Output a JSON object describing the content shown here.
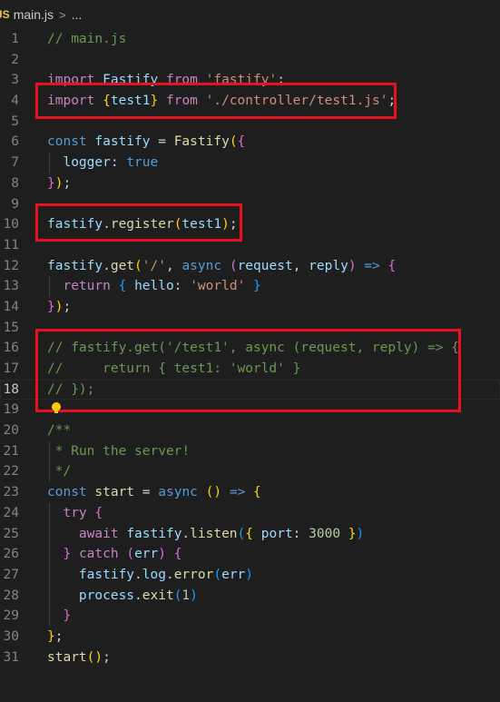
{
  "breadcrumb": {
    "badge": "JS",
    "file": "main.js",
    "separator": ">",
    "more": "..."
  },
  "lines": [
    {
      "n": "1",
      "tokens": [
        [
          "cmt",
          "// main.js"
        ]
      ]
    },
    {
      "n": "2",
      "tokens": []
    },
    {
      "n": "3",
      "tokens": [
        [
          "ctl",
          "import"
        ],
        [
          "pun",
          " "
        ],
        [
          "var",
          "Fastify"
        ],
        [
          "pun",
          " "
        ],
        [
          "ctl",
          "from"
        ],
        [
          "pun",
          " "
        ],
        [
          "str",
          "'fastify'"
        ],
        [
          "pun",
          ";"
        ]
      ]
    },
    {
      "n": "4",
      "tokens": [
        [
          "ctl",
          "import"
        ],
        [
          "pun",
          " "
        ],
        [
          "b1",
          "{"
        ],
        [
          "var",
          "test1"
        ],
        [
          "b1",
          "}"
        ],
        [
          "pun",
          " "
        ],
        [
          "ctl",
          "from"
        ],
        [
          "pun",
          " "
        ],
        [
          "str",
          "'./controller/test1.js'"
        ],
        [
          "pun",
          ";"
        ]
      ]
    },
    {
      "n": "5",
      "tokens": []
    },
    {
      "n": "6",
      "tokens": [
        [
          "kw",
          "const"
        ],
        [
          "pun",
          " "
        ],
        [
          "var",
          "fastify"
        ],
        [
          "pun",
          " = "
        ],
        [
          "fn",
          "Fastify"
        ],
        [
          "b1",
          "("
        ],
        [
          "b2",
          "{"
        ]
      ]
    },
    {
      "n": "7",
      "guide": true,
      "tokens": [
        [
          "pun",
          "  "
        ],
        [
          "var",
          "logger"
        ],
        [
          "pun",
          ": "
        ],
        [
          "kw",
          "true"
        ]
      ]
    },
    {
      "n": "8",
      "tokens": [
        [
          "b2",
          "}"
        ],
        [
          "b1",
          ")"
        ],
        [
          "pun",
          ";"
        ]
      ]
    },
    {
      "n": "9",
      "tokens": []
    },
    {
      "n": "10",
      "tokens": [
        [
          "var",
          "fastify"
        ],
        [
          "pun",
          "."
        ],
        [
          "fn",
          "register"
        ],
        [
          "b1",
          "("
        ],
        [
          "var",
          "test1"
        ],
        [
          "b1",
          ")"
        ],
        [
          "pun",
          ";"
        ]
      ]
    },
    {
      "n": "11",
      "tokens": []
    },
    {
      "n": "12",
      "tokens": [
        [
          "var",
          "fastify"
        ],
        [
          "pun",
          "."
        ],
        [
          "fn",
          "get"
        ],
        [
          "b1",
          "("
        ],
        [
          "str",
          "'/'"
        ],
        [
          "pun",
          ", "
        ],
        [
          "kw",
          "async"
        ],
        [
          "pun",
          " "
        ],
        [
          "b2",
          "("
        ],
        [
          "var",
          "request"
        ],
        [
          "pun",
          ", "
        ],
        [
          "var",
          "reply"
        ],
        [
          "b2",
          ")"
        ],
        [
          "pun",
          " "
        ],
        [
          "kw",
          "=>"
        ],
        [
          "pun",
          " "
        ],
        [
          "b2",
          "{"
        ]
      ]
    },
    {
      "n": "13",
      "guide": true,
      "tokens": [
        [
          "pun",
          "  "
        ],
        [
          "ctl",
          "return"
        ],
        [
          "pun",
          " "
        ],
        [
          "b3",
          "{"
        ],
        [
          "pun",
          " "
        ],
        [
          "var",
          "hello"
        ],
        [
          "pun",
          ": "
        ],
        [
          "str",
          "'world'"
        ],
        [
          "pun",
          " "
        ],
        [
          "b3",
          "}"
        ]
      ]
    },
    {
      "n": "14",
      "tokens": [
        [
          "b2",
          "}"
        ],
        [
          "b1",
          ")"
        ],
        [
          "pun",
          ";"
        ]
      ]
    },
    {
      "n": "15",
      "tokens": []
    },
    {
      "n": "16",
      "tokens": [
        [
          "cmt",
          "// fastify.get('/test1', async (request, reply) => {"
        ]
      ]
    },
    {
      "n": "17",
      "tokens": [
        [
          "cmt",
          "//     return { test1: 'world' }"
        ]
      ]
    },
    {
      "n": "18",
      "current": true,
      "tokens": [
        [
          "cmt",
          "// });"
        ]
      ]
    },
    {
      "n": "19",
      "tokens": []
    },
    {
      "n": "20",
      "tokens": [
        [
          "cmt",
          "/**"
        ]
      ]
    },
    {
      "n": "21",
      "guide": true,
      "tokens": [
        [
          "cmt",
          " * Run the server!"
        ]
      ]
    },
    {
      "n": "22",
      "guide": true,
      "tokens": [
        [
          "cmt",
          " */"
        ]
      ]
    },
    {
      "n": "23",
      "tokens": [
        [
          "kw",
          "const"
        ],
        [
          "pun",
          " "
        ],
        [
          "fn",
          "start"
        ],
        [
          "pun",
          " = "
        ],
        [
          "kw",
          "async"
        ],
        [
          "pun",
          " "
        ],
        [
          "b1",
          "()"
        ],
        [
          "pun",
          " "
        ],
        [
          "kw",
          "=>"
        ],
        [
          "pun",
          " "
        ],
        [
          "b1",
          "{"
        ]
      ]
    },
    {
      "n": "24",
      "guide": true,
      "tokens": [
        [
          "pun",
          "  "
        ],
        [
          "ctl",
          "try"
        ],
        [
          "pun",
          " "
        ],
        [
          "b2",
          "{"
        ]
      ]
    },
    {
      "n": "25",
      "guide": true,
      "tokens": [
        [
          "pun",
          "    "
        ],
        [
          "ctl",
          "await"
        ],
        [
          "pun",
          " "
        ],
        [
          "var",
          "fastify"
        ],
        [
          "pun",
          "."
        ],
        [
          "fn",
          "listen"
        ],
        [
          "b3",
          "("
        ],
        [
          "b1",
          "{"
        ],
        [
          "pun",
          " "
        ],
        [
          "var",
          "port"
        ],
        [
          "pun",
          ": "
        ],
        [
          "num",
          "3000"
        ],
        [
          "pun",
          " "
        ],
        [
          "b1",
          "}"
        ],
        [
          "b3",
          ")"
        ]
      ]
    },
    {
      "n": "26",
      "guide": true,
      "tokens": [
        [
          "pun",
          "  "
        ],
        [
          "b2",
          "}"
        ],
        [
          "pun",
          " "
        ],
        [
          "ctl",
          "catch"
        ],
        [
          "pun",
          " "
        ],
        [
          "b2",
          "("
        ],
        [
          "var",
          "err"
        ],
        [
          "b2",
          ")"
        ],
        [
          "pun",
          " "
        ],
        [
          "b2",
          "{"
        ]
      ]
    },
    {
      "n": "27",
      "guide": true,
      "tokens": [
        [
          "pun",
          "    "
        ],
        [
          "var",
          "fastify"
        ],
        [
          "pun",
          "."
        ],
        [
          "var",
          "log"
        ],
        [
          "pun",
          "."
        ],
        [
          "fn",
          "error"
        ],
        [
          "b3",
          "("
        ],
        [
          "var",
          "err"
        ],
        [
          "b3",
          ")"
        ]
      ]
    },
    {
      "n": "28",
      "guide": true,
      "tokens": [
        [
          "pun",
          "    "
        ],
        [
          "var",
          "process"
        ],
        [
          "pun",
          "."
        ],
        [
          "fn",
          "exit"
        ],
        [
          "b3",
          "("
        ],
        [
          "num",
          "1"
        ],
        [
          "b3",
          ")"
        ]
      ]
    },
    {
      "n": "29",
      "guide": true,
      "tokens": [
        [
          "pun",
          "  "
        ],
        [
          "b2",
          "}"
        ]
      ]
    },
    {
      "n": "30",
      "tokens": [
        [
          "b1",
          "}"
        ],
        [
          "pun",
          ";"
        ]
      ]
    },
    {
      "n": "31",
      "tokens": [
        [
          "fn",
          "start"
        ],
        [
          "b1",
          "()"
        ],
        [
          "pun",
          ";"
        ]
      ]
    }
  ],
  "theme": {
    "background": "#1e1e1e",
    "highlight_box": "#e81123",
    "lightbulb": "#ffcc00"
  }
}
